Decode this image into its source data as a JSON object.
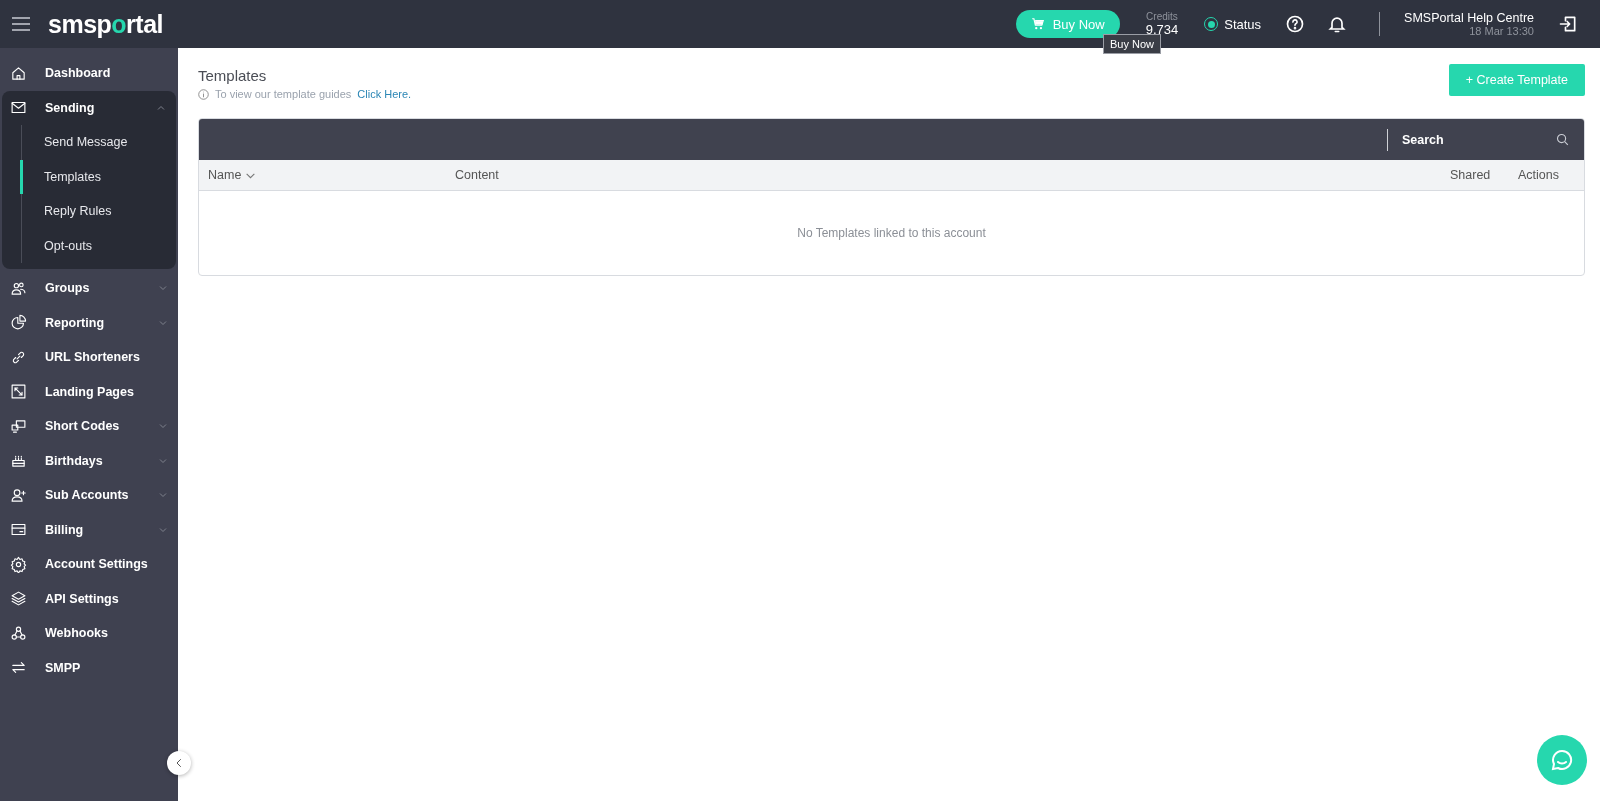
{
  "topbar": {
    "logo": [
      {
        "text": "smsp",
        "accent": false
      },
      {
        "text": "o",
        "accent": true
      },
      {
        "text": "rtal",
        "accent": false
      }
    ],
    "buy_button": "Buy Now",
    "tooltip": "Buy Now",
    "credits_label": "Credits",
    "credits_value": "9,734",
    "status": "Status",
    "help_title": "SMSPortal Help Centre",
    "help_date": "18 Mar 13:30"
  },
  "sidebar": {
    "items": [
      {
        "label": "Dashboard"
      },
      {
        "label": "Sending",
        "expanded": true,
        "children": [
          {
            "label": "Send Message",
            "selected": false
          },
          {
            "label": "Templates",
            "selected": true
          },
          {
            "label": "Reply Rules",
            "selected": false
          },
          {
            "label": "Opt-outs",
            "selected": false
          }
        ]
      },
      {
        "label": "Groups",
        "expanded": false
      },
      {
        "label": "Reporting",
        "expanded": false
      },
      {
        "label": "URL Shorteners"
      },
      {
        "label": "Landing Pages"
      },
      {
        "label": "Short Codes",
        "expanded": false
      },
      {
        "label": "Birthdays",
        "expanded": false
      },
      {
        "label": "Sub Accounts",
        "expanded": false
      },
      {
        "label": "Billing",
        "expanded": false
      },
      {
        "label": "Account Settings"
      },
      {
        "label": "API Settings"
      },
      {
        "label": "Webhooks"
      },
      {
        "label": "SMPP"
      }
    ]
  },
  "page": {
    "title": "Templates",
    "hint": "To view our template guides",
    "hint_link": "Click Here.",
    "create_button": "+ Create Template"
  },
  "table": {
    "search_placeholder": "Search",
    "columns": [
      "Name",
      "Content",
      "Shared",
      "Actions"
    ],
    "empty_message": "No Templates linked to this account"
  }
}
